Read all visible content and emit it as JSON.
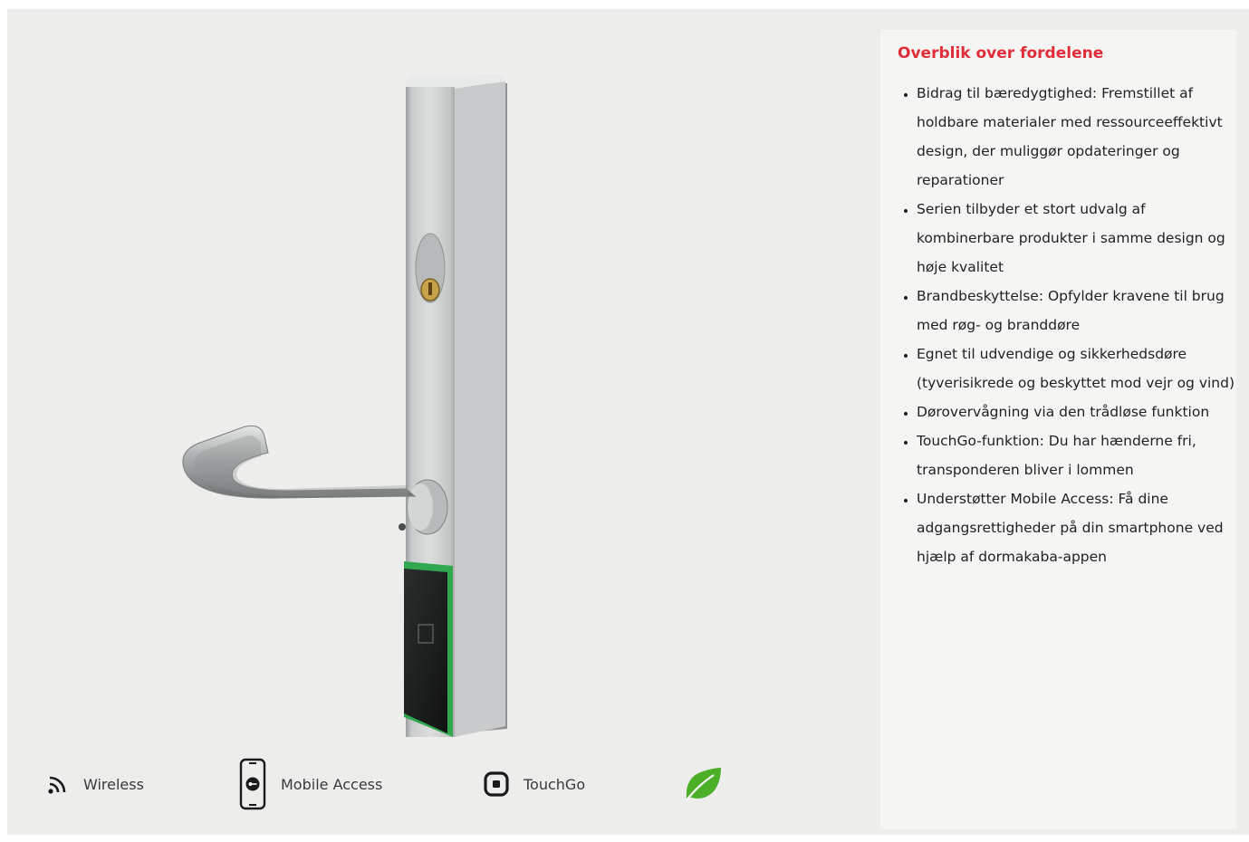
{
  "features": {
    "wireless": {
      "label": "Wireless",
      "icon": "wireless-icon"
    },
    "mobile_access": {
      "label": "Mobile Access",
      "icon": "smartphone-key-icon"
    },
    "touchgo": {
      "label": "TouchGo",
      "icon": "touchgo-icon"
    },
    "sustainability": {
      "icon": "leaf-icon",
      "color": "#4caf28"
    }
  },
  "benefits": {
    "title": "Overblik over fordelene",
    "title_color": "#e12d39",
    "items": [
      "Bidrag til bæredygtighed: Fremstillet af holdbare materialer med ressourceeffektivt design, der muliggør opdateringer og reparationer",
      "Serien tilbyder et stort udvalg af kombinerbare produkter i samme design og høje kvalitet",
      "Brandbeskyttelse: Opfylder kravene til brug med røg- og branddøre",
      "Egnet til udvendige og sikkerhedsdøre (tyverisikrede og beskyttet mod vejr og vind)",
      "Dørovervågning via den trådløse funktion",
      "TouchGo-funktion: Du har hænderne fri, transponderen bliver i lommen",
      "Understøtter Mobile Access: Få dine adgangsrettigheder på din smartphone ved hjælp af dormakaba-appen"
    ]
  }
}
